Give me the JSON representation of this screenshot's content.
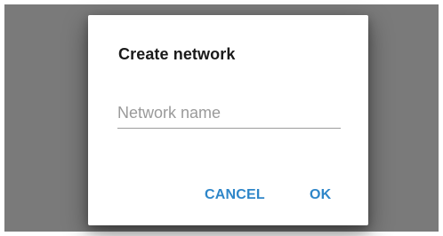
{
  "dialog": {
    "title": "Create network",
    "network_name_field": {
      "value": "",
      "placeholder": "Network name"
    },
    "actions": {
      "cancel_label": "CANCEL",
      "ok_label": "OK"
    }
  },
  "colors": {
    "scrim": "#7a7a7a",
    "dialog_background": "#ffffff",
    "title_text": "#1a1a1a",
    "placeholder_text": "#9a9a9a",
    "underline": "#9c9c9c",
    "accent": "#2e86c9"
  }
}
